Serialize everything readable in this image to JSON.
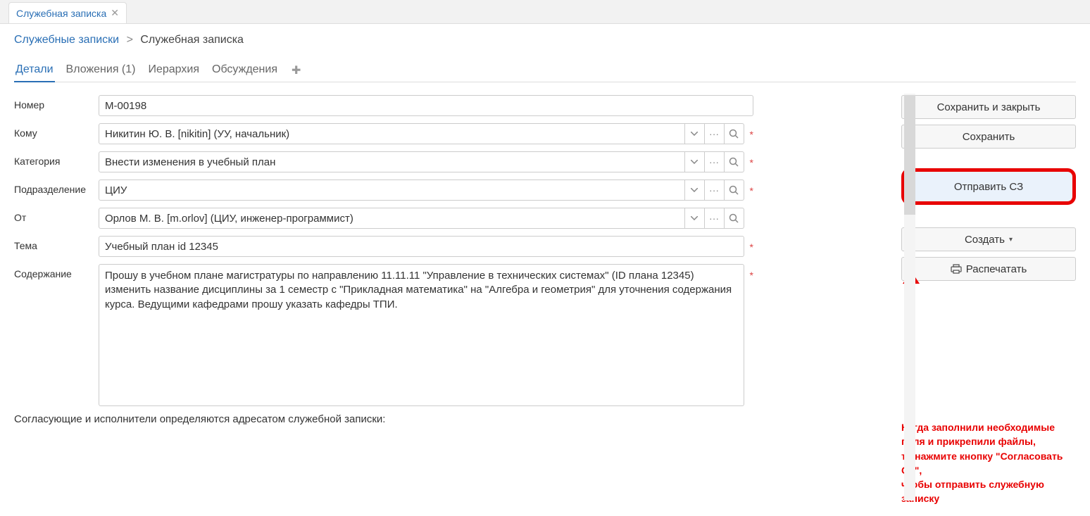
{
  "topTab": {
    "label": "Служебная записка"
  },
  "breadcrumb": {
    "root": "Служебные записки",
    "current": "Служебная записка"
  },
  "pageTabs": {
    "details": "Детали",
    "attachments": "Вложения (1)",
    "hierarchy": "Иерархия",
    "discussions": "Обсуждения"
  },
  "labels": {
    "number": "Номер",
    "to": "Кому",
    "category": "Категория",
    "dept": "Подразделение",
    "from": "От",
    "subject": "Тема",
    "content": "Содержание"
  },
  "fields": {
    "number": "М-00198",
    "to": "Никитин Ю. В. [nikitin] (УУ, начальник)",
    "category": "Внести изменения в учебный план",
    "dept": "ЦИУ",
    "from": "Орлов М. В. [m.orlov] (ЦИУ, инженер-программист)",
    "subject": "Учебный план id 12345",
    "content": "Прошу в учебном плане магистратуры по направлению 11.11.11 \"Управление в технических системах\" (ID плана 12345) изменить название дисциплины за 1 семестр с \"Прикладная математика\" на \"Алгебра и геометрия\" для уточнения содержания курса. Ведущими кафедрами прошу указать кафедры ТПИ."
  },
  "note": "Согласующие и исполнители определяются адресатом служебной записки:",
  "buttons": {
    "saveClose": "Сохранить и закрыть",
    "save": "Сохранить",
    "submit": "Отправить СЗ",
    "create": "Создать",
    "print": "Распечатать"
  },
  "help": "Когда заполнили необходимые\nполя и прикрепили файлы,\nто нажмите кнопку \"Согласовать СЗ\",\nчтобы отправить служебную записку"
}
